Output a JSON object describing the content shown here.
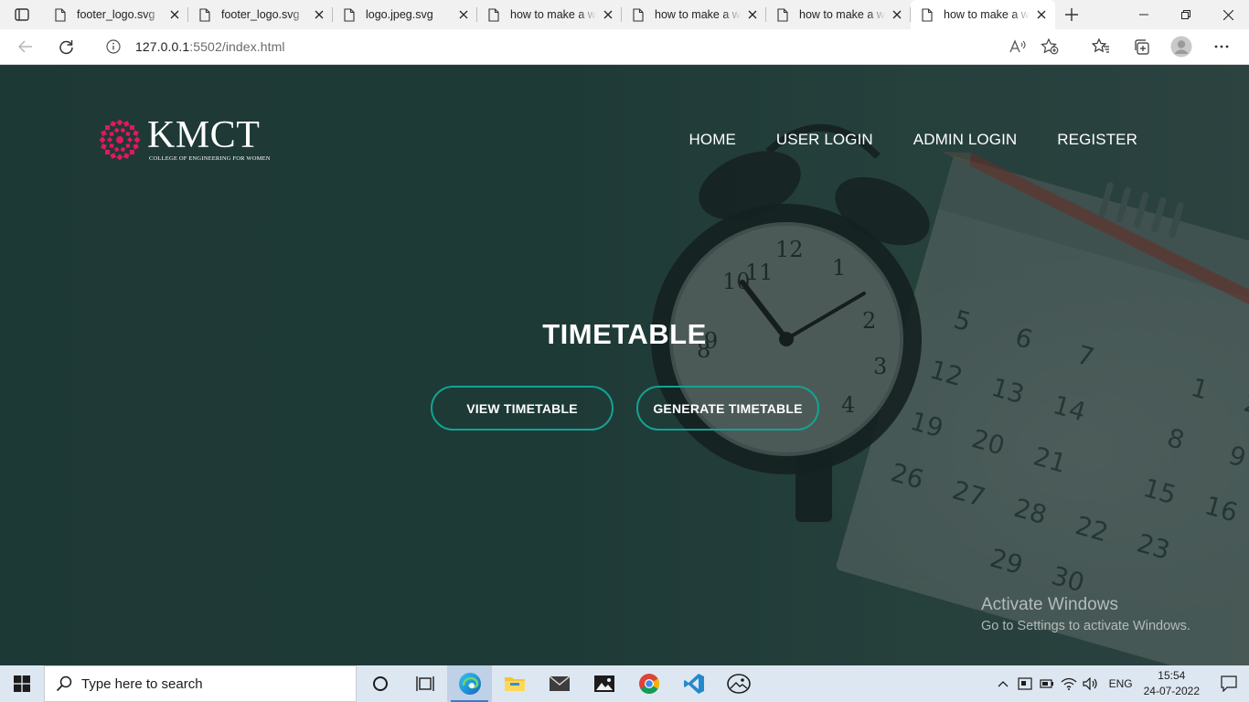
{
  "browser": {
    "tabs": [
      {
        "title": "footer_logo.svg",
        "active": false
      },
      {
        "title": "footer_logo.svg",
        "active": false
      },
      {
        "title": "logo.jpeg.svg",
        "active": false
      },
      {
        "title": "how to make a website",
        "active": false
      },
      {
        "title": "how to make a website",
        "active": false
      },
      {
        "title": "how to make a website",
        "active": false
      },
      {
        "title": "how to make a website",
        "active": true
      }
    ],
    "url_host": "127.0.0.1",
    "url_rest": ":5502/index.html"
  },
  "site": {
    "logo": {
      "title": "KMCT",
      "subtitle": "College of Engineering for Women",
      "color": "#e0195c"
    },
    "nav": [
      {
        "label": "HOME"
      },
      {
        "label": "USER LOGIN"
      },
      {
        "label": "ADMIN LOGIN"
      },
      {
        "label": "REGISTER"
      }
    ],
    "hero": {
      "title": "TIMETABLE",
      "buttons": [
        {
          "label": "VIEW TIMETABLE"
        },
        {
          "label": "GENERATE TIMETABLE"
        }
      ],
      "accent": "#13a393"
    },
    "watermark": {
      "line1": "Activate Windows",
      "line2": "Go to Settings to activate Windows."
    }
  },
  "taskbar": {
    "search_placeholder": "Type here to search",
    "apps": [
      "cortana-icon",
      "task-view-icon",
      "edge-icon",
      "file-explorer-icon",
      "mail-icon",
      "photos-icon",
      "chrome-icon",
      "vscode-icon",
      "photos-app-icon"
    ],
    "language": "ENG",
    "time": "15:54",
    "date": "24-07-2022"
  }
}
